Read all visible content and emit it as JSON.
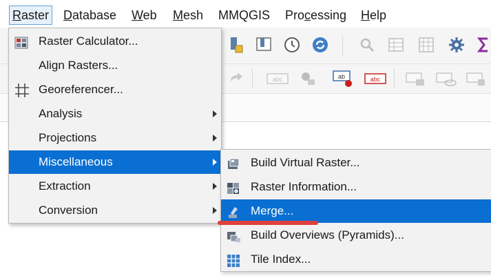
{
  "menubar": {
    "items": [
      {
        "key": "R",
        "rest": "aster"
      },
      {
        "key": "D",
        "rest": "atabase"
      },
      {
        "key": "W",
        "rest": "eb"
      },
      {
        "key": "M",
        "rest": "esh"
      },
      {
        "key": "",
        "rest": "MMQGIS"
      },
      {
        "pre": "Pro",
        "key": "c",
        "rest": "essing"
      },
      {
        "key": "H",
        "rest": "elp"
      }
    ]
  },
  "raster_menu": {
    "items": [
      {
        "label": "Raster Calculator...",
        "icon": "raster-calculator-icon"
      },
      {
        "label": "Align Rasters...",
        "icon": ""
      },
      {
        "label": "Georeferencer...",
        "icon": "georeferencer-grid-icon"
      },
      {
        "label": "Analysis",
        "submenu": true
      },
      {
        "label": "Projections",
        "submenu": true
      },
      {
        "label": "Miscellaneous",
        "submenu": true,
        "highlighted": true
      },
      {
        "label": "Extraction",
        "submenu": true
      },
      {
        "label": "Conversion",
        "submenu": true
      }
    ]
  },
  "misc_submenu": {
    "items": [
      {
        "label": "Build Virtual Raster...",
        "icon": "build-virtual-raster-icon"
      },
      {
        "label": "Raster Information...",
        "icon": "raster-information-icon"
      },
      {
        "label": "Merge...",
        "icon": "merge-icon",
        "highlighted": true
      },
      {
        "label": "Build Overviews (Pyramids)...",
        "icon": "build-overviews-icon"
      },
      {
        "label": "Tile Index...",
        "icon": "tile-index-icon"
      }
    ]
  },
  "toolbar_icons": {
    "row1": [
      "add-bookmark-icon",
      "show-bookmarks-icon",
      "temporal-clock-icon",
      "refresh-icon",
      "identify-icon",
      "attribute-table-icon",
      "field-calculator-icon",
      "settings-gear-icon",
      "statistics-sum-icon"
    ],
    "row2": [
      "redo-icon",
      "label-abc-icon",
      "pin-label-icon",
      "label-ab-icon",
      "label-abc-red-icon",
      "label-highlight-icon",
      "label-show-icon",
      "label-move-icon"
    ]
  },
  "colors": {
    "highlight": "#0a6fd2",
    "menu_background": "#f2f2f2",
    "annotation_red": "#e0403c"
  }
}
